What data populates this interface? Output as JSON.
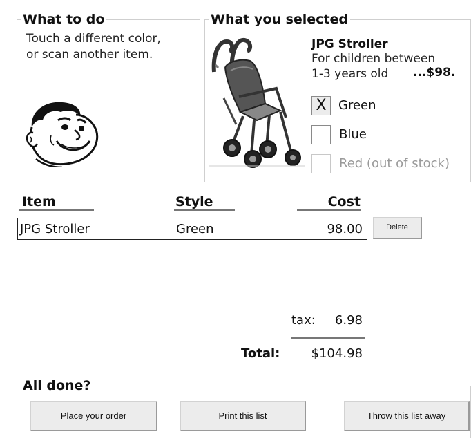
{
  "what_to_do": {
    "title": "What to do",
    "instruction_line1": "Touch a different color,",
    "instruction_line2": "or scan another item."
  },
  "selection": {
    "title": "What you selected",
    "product_name": "JPG Stroller",
    "description_line1": "For children between",
    "description_line2": "1-3 years old",
    "price": "...$98.",
    "options": [
      {
        "mark": "X",
        "label": "Green",
        "checked": true,
        "available": true
      },
      {
        "mark": "",
        "label": "Blue",
        "checked": false,
        "available": true
      },
      {
        "mark": "",
        "label": "Red (out of stock)",
        "checked": false,
        "available": false
      }
    ]
  },
  "order_table": {
    "headers": {
      "item": "Item",
      "style": "Style",
      "cost": "Cost"
    },
    "rows": [
      {
        "item": "JPG Stroller",
        "style": "Green",
        "cost": "98.00",
        "delete_label": "Delete"
      }
    ],
    "tax_label": "tax:",
    "tax_value": "6.98",
    "total_label": "Total:",
    "total_value": "$104.98"
  },
  "all_done": {
    "title": "All done?",
    "place_order_label": "Place your order",
    "print_list_label": "Print this list",
    "throw_away_label": "Throw this list away"
  },
  "icons": {
    "mascot": "cartoon-face-icon",
    "product_image": "stroller-icon"
  }
}
